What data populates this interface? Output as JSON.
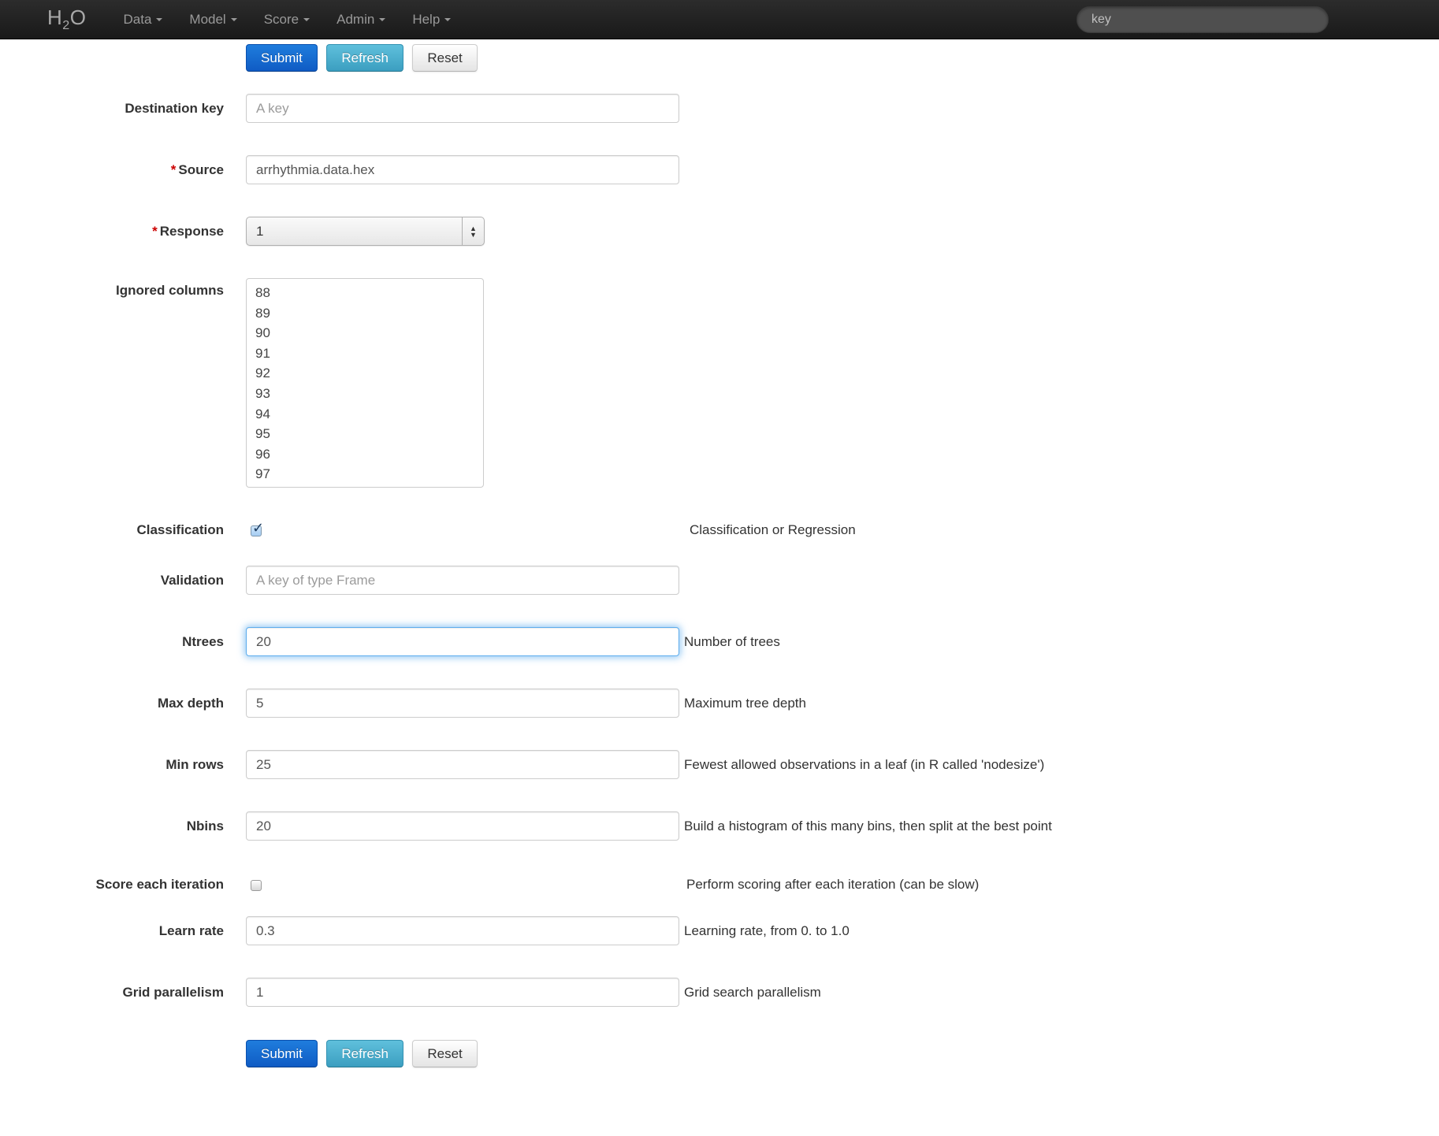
{
  "navbar": {
    "brand": {
      "prefix": "H",
      "sub": "2",
      "suffix": "O"
    },
    "menu": [
      {
        "label": "Data"
      },
      {
        "label": "Model"
      },
      {
        "label": "Score"
      },
      {
        "label": "Admin"
      },
      {
        "label": "Help"
      }
    ],
    "search": {
      "value": "key"
    }
  },
  "toolbar": {
    "submit_label": "Submit",
    "refresh_label": "Refresh",
    "reset_label": "Reset"
  },
  "form": {
    "destination_key": {
      "label": "Destination key",
      "placeholder": "A key"
    },
    "source": {
      "label": "Source",
      "required": "*",
      "value": "arrhythmia.data.hex"
    },
    "response": {
      "label": "Response",
      "required": "*",
      "value": "1"
    },
    "ignored_columns": {
      "label": "Ignored columns",
      "options": [
        "88",
        "89",
        "90",
        "91",
        "92",
        "93",
        "94",
        "95",
        "96",
        "97"
      ]
    },
    "classification": {
      "label": "Classification",
      "checked": true,
      "help": "Classification or Regression"
    },
    "validation": {
      "label": "Validation",
      "placeholder": "A key of type Frame"
    },
    "ntrees": {
      "label": "Ntrees",
      "value": "20",
      "help": "Number of trees",
      "focused": true
    },
    "max_depth": {
      "label": "Max depth",
      "value": "5",
      "help": "Maximum tree depth"
    },
    "min_rows": {
      "label": "Min rows",
      "value": "25",
      "help": "Fewest allowed observations in a leaf (in R called 'nodesize')"
    },
    "nbins": {
      "label": "Nbins",
      "value": "20",
      "help": "Build a histogram of this many bins, then split at the best point"
    },
    "score_each_iteration": {
      "label": "Score each iteration",
      "checked": false,
      "help": "Perform scoring after each iteration (can be slow)"
    },
    "learn_rate": {
      "label": "Learn rate",
      "value": "0.3",
      "help": "Learning rate, from 0. to 1.0"
    },
    "grid_parallelism": {
      "label": "Grid parallelism",
      "value": "1",
      "help": "Grid search parallelism"
    }
  },
  "colors": {
    "navbar_bg": "#1e1e1e",
    "primary_button": "#1267c2",
    "info_button": "#46a7c6",
    "focus_glow": "#5dadee",
    "required_red": "#cc0000"
  }
}
